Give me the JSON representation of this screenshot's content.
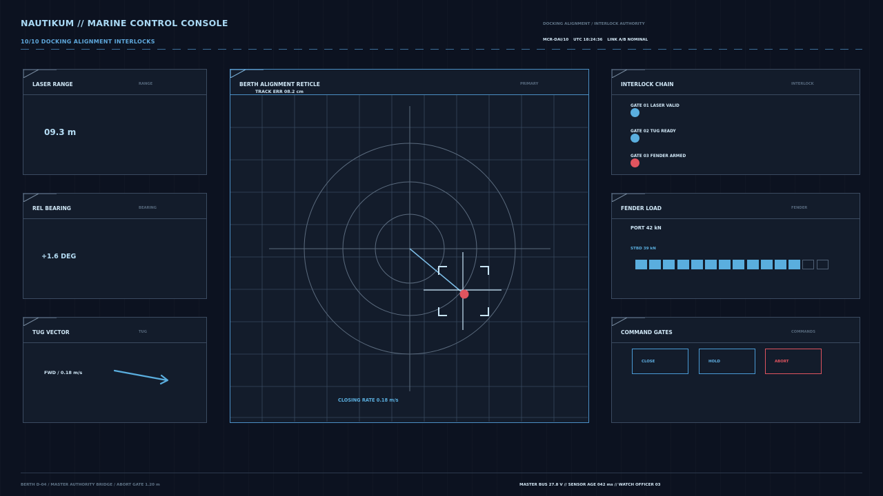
{
  "header": {
    "title": "NAUTIKUM // MARINE CONTROL CONSOLE",
    "subtitle": "10/10  DOCKING ALIGNMENT INTERLOCKS",
    "right_top": "DOCKING ALIGNMENT / INTERLOCK AUTHORITY",
    "status": [
      "MCR-DAI/10",
      "UTC 18:24:36",
      "LINK A/B NOMINAL"
    ]
  },
  "laser_range": {
    "title": "LASER RANGE",
    "tag": "RANGE",
    "value": "09.3 m"
  },
  "rel_bearing": {
    "title": "REL BEARING",
    "tag": "BEARING",
    "value": "+1.6 DEG"
  },
  "tug_vector": {
    "title": "TUG VECTOR",
    "tag": "TUG",
    "value": "FWD / 0.18 m/s"
  },
  "reticle": {
    "title": "BERTH ALIGNMENT RETICLE",
    "subtitle": "TRACK ERR 08.2 cm",
    "tag": "PRIMARY",
    "closing_rate": "CLOSING RATE 0.18 m/s"
  },
  "interlock": {
    "title": "INTERLOCK CHAIN",
    "tag": "INTERLOCK",
    "gates": [
      {
        "label": "GATE 01 LASER VALID",
        "state": "ok"
      },
      {
        "label": "GATE 02 TUG READY",
        "state": "ok"
      },
      {
        "label": "GATE 03 FENDER ARMED",
        "state": "alarm"
      }
    ]
  },
  "fender": {
    "title": "FENDER LOAD",
    "tag": "FENDER",
    "port": "PORT 42 kN",
    "stbd": "STBD 39 kN",
    "segments_total": 14,
    "segments_lit": 12
  },
  "commands": {
    "title": "COMMAND GATES",
    "tag": "COMMANDS",
    "close": "CLOSE",
    "hold": "HOLD",
    "abort": "ABORT"
  },
  "footer": {
    "left": "BERTH D-04 / MASTER AUTHORITY BRIDGE / ABORT GATE 1.20 m",
    "right": "MASTER BUS 27.8 V  //  SENSOR AGE 042 ms  //  WATCH OFFICER 03"
  },
  "colors": {
    "accent": "#5aaede",
    "alarm": "#e0545f",
    "panel": "#131c2b",
    "background": "#0c1220"
  }
}
